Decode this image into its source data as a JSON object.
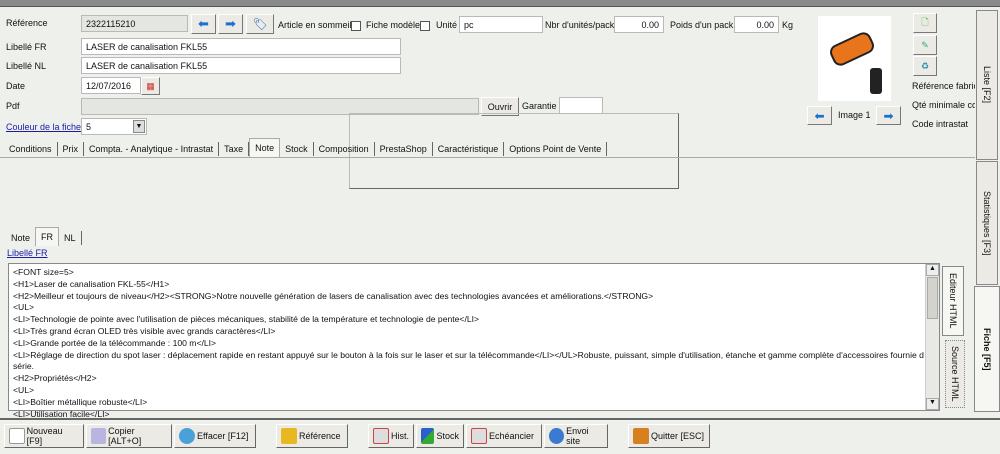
{
  "window": {
    "title": "Articles : 2322115210"
  },
  "form": {
    "reference_label": "Référence",
    "reference": "2322115210",
    "sommeil_label": "Article en sommeil",
    "modele_label": "Fiche modèle",
    "unite_label": "Unité",
    "unite": "pc",
    "nbr_label": "Nbr d'unités/pack",
    "nbr": "0.00",
    "poids_label": "Poids d'un pack",
    "poids": "0.00",
    "kg": "Kg",
    "libfr_label": "Libellé FR",
    "libfr": "LASER de canalisation FKL55",
    "libnl_label": "Libellé NL",
    "libnl": "LASER de canalisation FKL55",
    "date_label": "Date",
    "date": "12/07/2016",
    "pdf_label": "Pdf",
    "pdf": "",
    "ouvrir": "Ouvrir",
    "garantie_label": "Garantie",
    "garantie": "",
    "couleur_label": "Couleur de la fiche",
    "couleur": "5"
  },
  "image": {
    "caption": "Image 1"
  },
  "side_info": [
    "Référence fabric",
    "Qté minimale con",
    "Code intrastat"
  ],
  "main_tabs": [
    "Conditions",
    "Prix",
    "Compta. - Analytique - Intrastat",
    "Taxe",
    "Note",
    "Stock",
    "Composition",
    "PrestaShop",
    "Caractéristique",
    "Options Point de Vente"
  ],
  "note_tabs": [
    "Note",
    "FR",
    "NL"
  ],
  "libelle_link": "Libellé FR",
  "editor_lines": [
    "<FONT size=5>",
    "<H1>Laser de canalisation FKL-55</H1>",
    "<H2>Meilleur et toujours de niveau</H2><STRONG>Notre nouvelle génération de lasers de canalisation avec des technologies avancées et améliorations.</STRONG>",
    "<UL>",
    "<LI>Technologie de pointe avec l'utilisation de pièces mécaniques, stabilité de la température et technologie de pente</LI>",
    "<LI>Très grand écran OLED très visible avec grands caractères</LI>",
    "<LI>Grande portée de la télécommande : 100 m</LI>",
    "<LI>Réglage de direction du spot laser : déplacement rapide en restant appuyé sur le bouton à la fois sur le laser et sur la télécommande</LI></UL>Robuste, puissant, simple d'utilisation, étanche et gamme complète d'accessoires fournie de",
    "série.",
    "<H2>Propriétés</H2>",
    "<UL>",
    "<LI>Boîtier métallique robuste</LI>",
    "<LI>Utilisation facile</LI>"
  ],
  "editor_tabs": [
    "Editeur HTML",
    "Source HTML"
  ],
  "right_tabs": [
    "Liste [F2]",
    "Statistiques [F3]",
    "Fiche [F5]"
  ],
  "toolbar": [
    "Nouveau [F9]",
    "Copier [ALT+O]",
    "Effacer [F12]",
    "Référence",
    "Hist.",
    "Stock",
    "Echéancier",
    "Envoi site",
    "Quitter [ESC]"
  ]
}
